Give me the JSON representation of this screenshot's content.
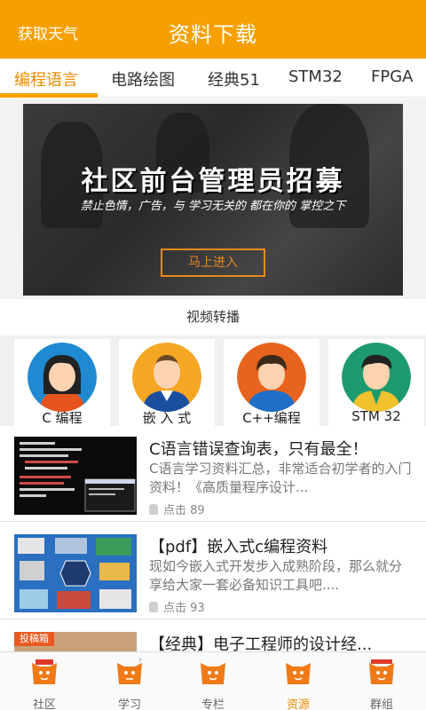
{
  "header": {
    "left_action": "获取天气",
    "title": "资料下载"
  },
  "tabs": [
    {
      "label": "编程语言",
      "active": true
    },
    {
      "label": "电路绘图",
      "active": false
    },
    {
      "label": "经典51",
      "active": false
    },
    {
      "label": "STM32",
      "active": false
    },
    {
      "label": "FPGA",
      "active": false
    }
  ],
  "banner": {
    "heading": "社区前台管理员招募",
    "subtitle": "禁止色情，广告，与 学习无关的 都在你的 掌控之下",
    "button_label": "马上进入"
  },
  "section_title": "视频转播",
  "categories": [
    {
      "label": "C  编程",
      "avatar": "girl-avatar-icon",
      "bg": "#1f8ad2"
    },
    {
      "label": "嵌 入 式",
      "avatar": "bald-man-avatar-icon",
      "bg": "#f5a623"
    },
    {
      "label": "C++编程",
      "avatar": "boy-avatar-icon",
      "bg": "#e8641e"
    },
    {
      "label": "STM  32",
      "avatar": "man-avatar-icon",
      "bg": "#1e9b6e"
    }
  ],
  "articles": [
    {
      "title": "C语言错误查询表，只有最全！",
      "desc": "C语言学习资料汇总，非常适合初学者的入门资料！《高质量程序设计...",
      "clicks": "点击 89",
      "thumb": "code-screenshot"
    },
    {
      "title": "【pdf】嵌入式c编程资料",
      "desc": "现如今嵌入式开发步入成熟阶段，那么就分享给大家一套必备知识工具吧....",
      "clicks": "点击 93",
      "thumb": "arm-embedded-diagram"
    },
    {
      "title": "【经典】电子工程师的设计经...",
      "desc": "",
      "clicks": "",
      "thumb": "submission-banner",
      "thumb_tag": "投稿箱"
    }
  ],
  "bottom_nav": [
    {
      "label": "社区",
      "icon": "community-mascot-icon",
      "active": false
    },
    {
      "label": "学习",
      "icon": "study-mascot-icon",
      "active": false
    },
    {
      "label": "专栏",
      "icon": "column-mascot-icon",
      "active": false
    },
    {
      "label": "资源",
      "icon": "resource-mascot-icon",
      "active": true
    },
    {
      "label": "群组",
      "icon": "group-mascot-icon",
      "active": false
    }
  ],
  "colors": {
    "brand": "#f5a000",
    "active_text": "#f08a00"
  }
}
